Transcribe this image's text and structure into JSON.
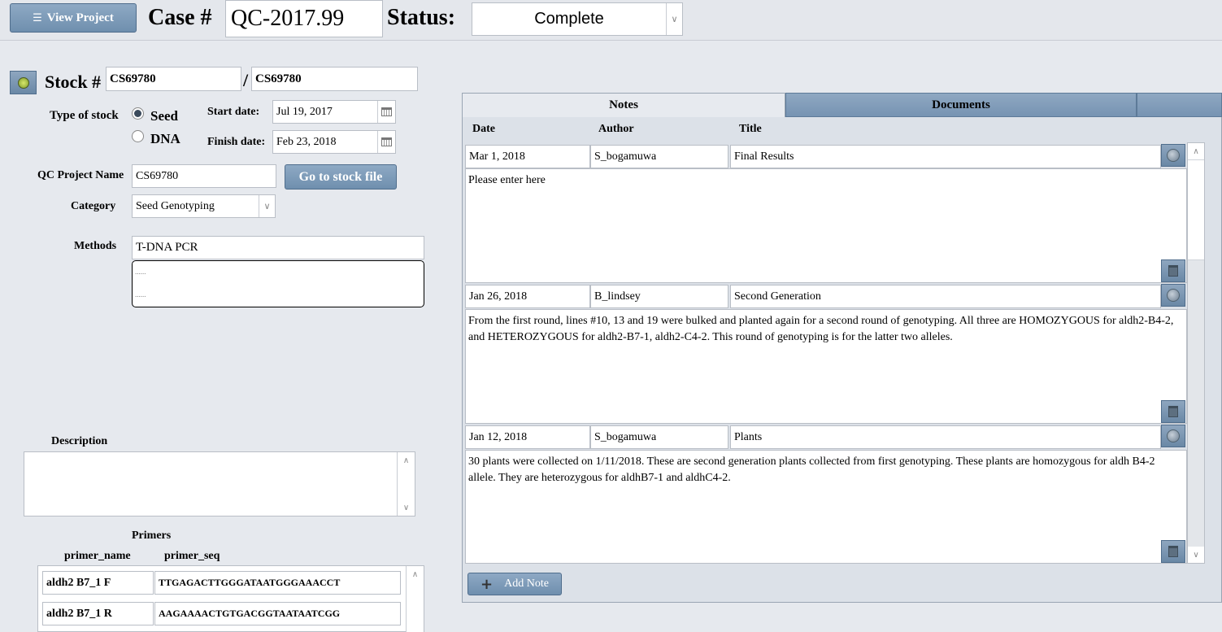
{
  "header": {
    "view_project_label": "View Project",
    "case_label": "Case #",
    "case_value": "QC-2017.99",
    "status_label": "Status:",
    "status_value": "Complete"
  },
  "stock": {
    "label": "Stock #",
    "value1": "CS69780",
    "separator": "/",
    "value2": "CS69780",
    "type_label": "Type of stock",
    "type_options": [
      "Seed",
      "DNA"
    ],
    "type_selected": "Seed",
    "start_label": "Start date:",
    "start_value": "Jul 19, 2017",
    "finish_label": "Finish date:",
    "finish_value": "Feb 23, 2018",
    "qc_name_label": "QC Project Name",
    "qc_name_value": "CS69780",
    "go_button": "Go to stock file",
    "category_label": "Category",
    "category_value": "Seed Genotyping",
    "methods_label": "Methods",
    "methods_value": "T-DNA PCR",
    "methods_dots1": "......",
    "methods_dots2": "......",
    "description_label": "Description",
    "description_value": ""
  },
  "primers": {
    "title": "Primers",
    "col_name": "primer_name",
    "col_seq": "primer_seq",
    "rows": [
      {
        "name": "aldh2 B7_1 F",
        "seq": "TTGAGACTTGGGATAATGGGAAACCT"
      },
      {
        "name": "aldh2 B7_1 R",
        "seq": "AAGAAAACTGTGACGGTAATAATCGG"
      }
    ]
  },
  "tabs": {
    "notes": "Notes",
    "documents": "Documents"
  },
  "notes": {
    "col_date": "Date",
    "col_author": "Author",
    "col_title": "Title",
    "items": [
      {
        "date": "Mar 1, 2018",
        "author": "S_bogamuwa",
        "title": "Final Results",
        "body": "Please enter here"
      },
      {
        "date": "Jan 26, 2018",
        "author": "B_lindsey",
        "title": "Second Generation",
        "body": "From the first round, lines #10, 13 and 19 were bulked and planted again for a second round of genotyping. All three are HOMOZYGOUS for aldh2-B4-2, and HETEROZYGOUS for aldh2-B7-1, aldh2-C4-2. This round of genotyping is for the latter two alleles."
      },
      {
        "date": "Jan 12, 2018",
        "author": "S_bogamuwa",
        "title": "Plants",
        "body": "30 plants were collected on 1/11/2018.  These are second generation plants collected from first genotyping.  These plants are homozygous for aldh B4-2 allele.  They are heterozygous for aldhB7-1 and aldhC4-2."
      }
    ],
    "add_label": "Add Note"
  }
}
